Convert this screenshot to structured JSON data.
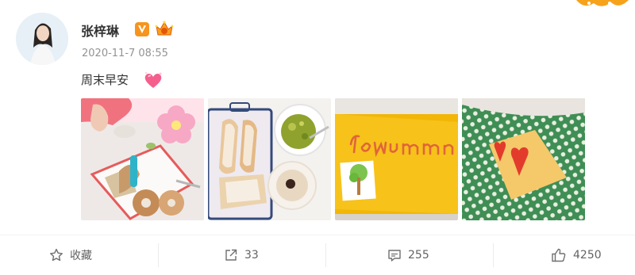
{
  "post": {
    "username": "张梓琳",
    "timestamp": "2020-11-7 08:55",
    "text": "周末早安",
    "badges": [
      "verified-v-icon",
      "level-crown-icon"
    ],
    "emoji": "heart-emoji",
    "images": [
      {
        "name": "photo-breakfast-tray"
      },
      {
        "name": "photo-bread-avocado"
      },
      {
        "name": "photo-yellow-card"
      },
      {
        "name": "photo-heart-card"
      }
    ]
  },
  "actions": {
    "favorite": {
      "label": "收藏",
      "icon": "star-icon"
    },
    "repost": {
      "count": "33",
      "icon": "share-icon"
    },
    "comment": {
      "count": "255",
      "icon": "comment-icon"
    },
    "like": {
      "count": "4250",
      "icon": "thumbs-up-icon"
    }
  },
  "colors": {
    "text": "#333333",
    "meta": "#939393",
    "action": "#636363",
    "vip": "#f7941d"
  }
}
